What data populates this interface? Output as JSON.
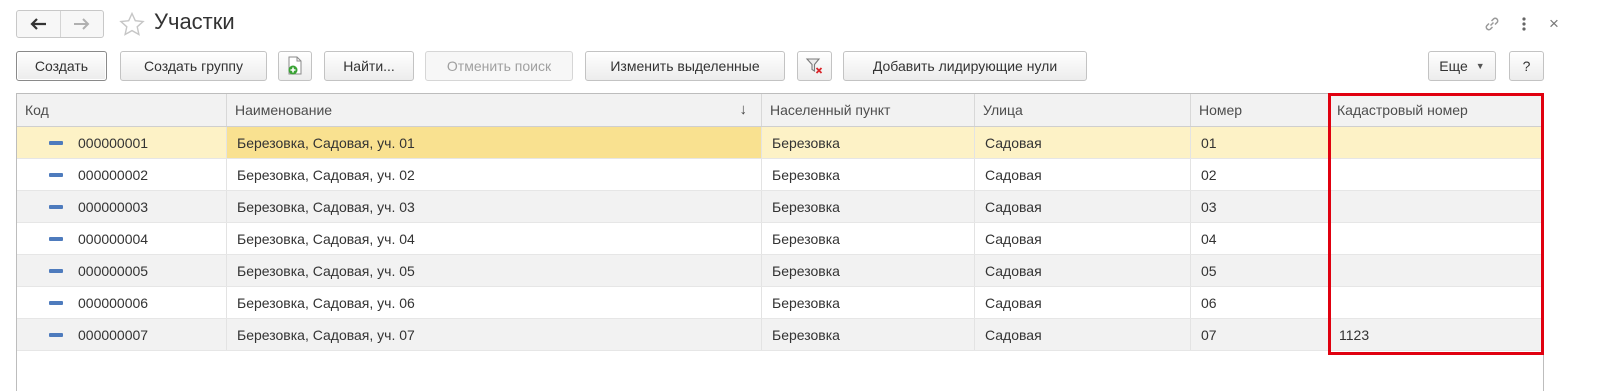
{
  "window": {
    "title": "Участки",
    "back_icon": "arrow-left-icon",
    "forward_icon": "arrow-right-icon",
    "favorite_icon": "star-icon",
    "link_icon": "link-icon",
    "menu_icon": "more-vertical-icon",
    "close_label": "×"
  },
  "toolbar": {
    "create": "Создать",
    "create_group": "Создать группу",
    "copy_icon": "add-copy-icon",
    "find": "Найти...",
    "cancel_search": "Отменить поиск",
    "edit_selected": "Изменить выделенные",
    "filter_clear_icon": "filter-clear-icon",
    "add_leading_zeros": "Добавить лидирующие нули",
    "more": "Еще",
    "help": "?"
  },
  "table": {
    "columns": [
      "Код",
      "Наименование",
      "Населенный пункт",
      "Улица",
      "Номер",
      "Кадастровый номер"
    ],
    "sort_indicator": "↓",
    "rows": [
      {
        "code": "000000001",
        "name": "Березовка, Садовая, уч. 01",
        "settlement": "Березовка",
        "street": "Садовая",
        "number": "01",
        "cadastral": ""
      },
      {
        "code": "000000002",
        "name": "Березовка, Садовая, уч. 02",
        "settlement": "Березовка",
        "street": "Садовая",
        "number": "02",
        "cadastral": ""
      },
      {
        "code": "000000003",
        "name": "Березовка, Садовая, уч. 03",
        "settlement": "Березовка",
        "street": "Садовая",
        "number": "03",
        "cadastral": ""
      },
      {
        "code": "000000004",
        "name": "Березовка, Садовая, уч. 04",
        "settlement": "Березовка",
        "street": "Садовая",
        "number": "04",
        "cadastral": ""
      },
      {
        "code": "000000005",
        "name": "Березовка, Садовая, уч. 05",
        "settlement": "Березовка",
        "street": "Садовая",
        "number": "05",
        "cadastral": ""
      },
      {
        "code": "000000006",
        "name": "Березовка, Садовая, уч. 06",
        "settlement": "Березовка",
        "street": "Садовая",
        "number": "06",
        "cadastral": ""
      },
      {
        "code": "000000007",
        "name": "Березовка, Садовая, уч. 07",
        "settlement": "Березовка",
        "street": "Садовая",
        "number": "07",
        "cadastral": "1123"
      }
    ]
  },
  "colors": {
    "selected_row": "#fdf2c6",
    "current_cell": "#f9e190",
    "highlight_frame": "#e0000f",
    "item_icon": "#4e7bbd"
  }
}
